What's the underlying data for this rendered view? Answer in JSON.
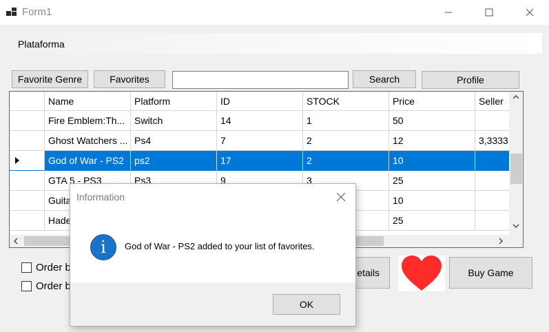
{
  "window": {
    "title": "Form1"
  },
  "menu": {
    "items": [
      "Plataforma"
    ]
  },
  "toolbar": {
    "favorite_genre_label": "Favorite Genre",
    "favorites_label": "Favorites",
    "search_value": "",
    "search_label": "Search",
    "profile_label": "Profile"
  },
  "grid": {
    "columns": [
      "Name",
      "Platform",
      "ID",
      "STOCK",
      "Price",
      "Seller"
    ],
    "rows": [
      [
        "Fire Emblem:Th...",
        "Switch",
        "14",
        "1",
        "50",
        ""
      ],
      [
        "Ghost Watchers ...",
        "Ps4",
        "7",
        "2",
        "12",
        "3,3333"
      ],
      [
        "God of War - PS2",
        "ps2",
        "17",
        "2",
        "10",
        ""
      ],
      [
        "GTA 5 - PS3",
        "Ps3",
        "9",
        "3",
        "25",
        ""
      ],
      [
        "Guita",
        "",
        "",
        "",
        "10",
        ""
      ],
      [
        "Hade",
        "",
        "",
        "",
        "25",
        ""
      ]
    ],
    "selected_row": 2
  },
  "options": {
    "order_1_label": "Order b",
    "order_2_label": "Order b"
  },
  "actions": {
    "details_label": "etails",
    "buy_label": "Buy  Game"
  },
  "dialog": {
    "title": "Information",
    "message": "God of War - PS2 added to your list of favorites.",
    "ok_label": "OK",
    "icon": "info-icon"
  },
  "colors": {
    "selection": "#0078d7",
    "heart": "#ff2a2a",
    "info": "#1a73c8"
  }
}
